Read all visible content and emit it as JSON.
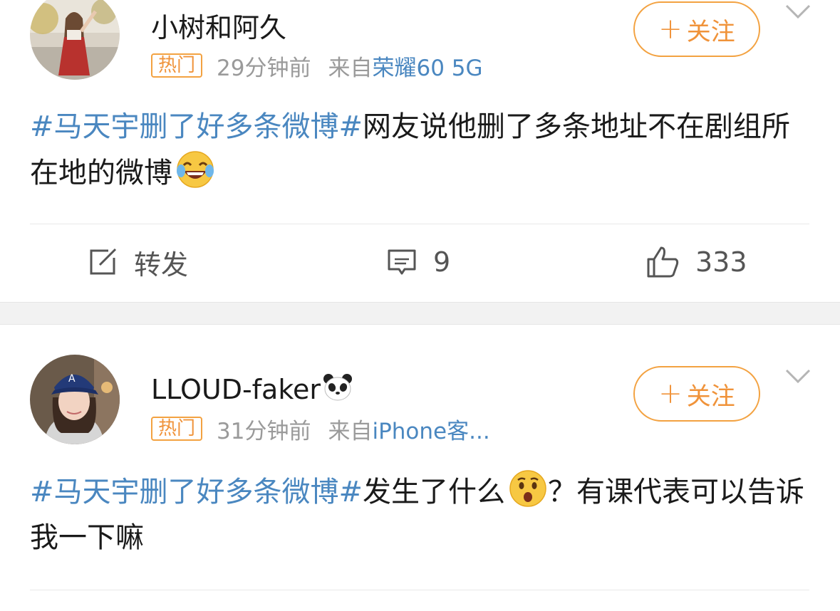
{
  "posts": [
    {
      "username": "小树和阿久",
      "badge": "热门",
      "time": "29分钟前",
      "source_prefix": "来自",
      "device": "荣耀60 5G",
      "follow_label": "关注",
      "follow_plus": "+",
      "hashtag": "#马天宇删了好多条微博#",
      "text": "网友说他删了多条地址不在剧组所在地的微博",
      "emoji": "laughing-tears",
      "actions": {
        "repost": "转发",
        "comments": "9",
        "likes": "333"
      }
    },
    {
      "username": "LLOUD-faker",
      "username_emoji": "panda",
      "badge": "热门",
      "time": "31分钟前",
      "source_prefix": "来自",
      "device": "iPhone客...",
      "follow_label": "关注",
      "follow_plus": "+",
      "hashtag": "#马天宇删了好多条微博#",
      "text_before_emoji": "发生了什么",
      "emoji": "surprised",
      "text_after_emoji": "？有课代表可以告诉我一下嘛"
    }
  ],
  "colors": {
    "link_blue": "#4a87c0",
    "accent_orange": "#f0933a",
    "meta_gray": "#9a9a9a",
    "separator_gray": "#f2f2f2"
  }
}
